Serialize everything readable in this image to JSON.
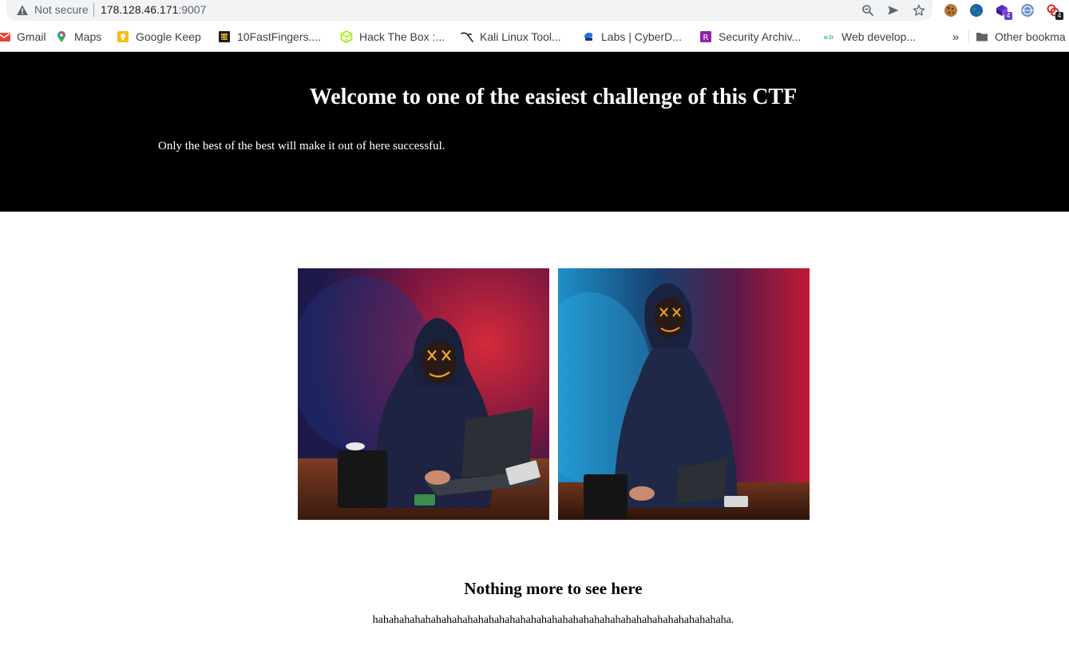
{
  "browser": {
    "security_label": "Not secure",
    "url_host": "178.128.46.171",
    "url_port": ":9007",
    "extension_badges": [
      "4",
      "4"
    ],
    "bookmarks": [
      {
        "label": "Gmail",
        "icon": "gmail-icon"
      },
      {
        "label": "Maps",
        "icon": "maps-pin-icon"
      },
      {
        "label": "Google Keep",
        "icon": "google-keep-icon"
      },
      {
        "label": "10FastFingers....",
        "icon": "10fastfingers-icon"
      },
      {
        "label": "Hack The Box :...",
        "icon": "hackthebox-cube-icon"
      },
      {
        "label": "Kali Linux Tool...",
        "icon": "kali-dragon-icon"
      },
      {
        "label": "Labs | CyberD...",
        "icon": "cyberdefenders-icon"
      },
      {
        "label": "Security Archiv...",
        "icon": "security-archive-icon"
      },
      {
        "label": "Web develop...",
        "icon": "w3schools-icon"
      }
    ],
    "overflow_label": "»",
    "other_bookmarks_label": "Other bookma"
  },
  "page": {
    "title": "Welcome to one of the easiest challenge of this CTF",
    "subtitle": "Only the best of the best will make it out of here successful.",
    "footer_heading": "Nothing more to see here",
    "footer_text": "hahahahahahahahahahahahahahahahahahahahahahahahahahahahahahahahahaha."
  },
  "colors": {
    "hero_background": "#000000",
    "hero_text": "#ffffff",
    "photo_left_smoke": "#b3172a",
    "photo_right_smoke": "#1e90c8",
    "mask_glow": "#f5a623"
  }
}
